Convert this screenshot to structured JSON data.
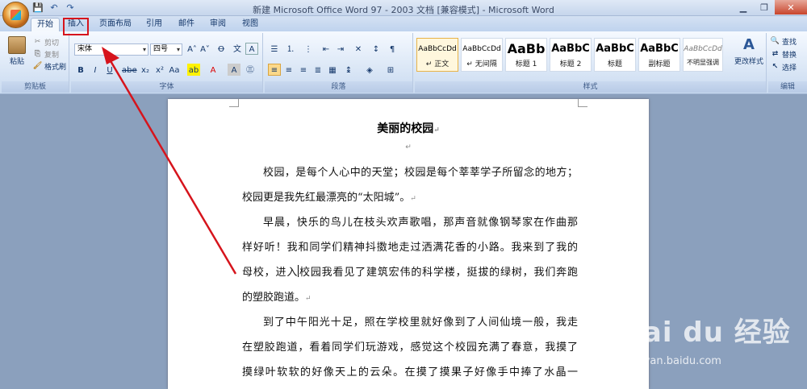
{
  "window": {
    "title": "新建 Microsoft Office Word 97 - 2003 文档 [兼容模式] - Microsoft Word",
    "controls": [
      "minimize",
      "restore",
      "close"
    ]
  },
  "qat_icons": [
    "save-icon",
    "undo-icon",
    "redo-icon"
  ],
  "tabs": [
    {
      "label": "开始",
      "active": true
    },
    {
      "label": "插入",
      "active": false,
      "highlighted": true
    },
    {
      "label": "页面布局",
      "active": false
    },
    {
      "label": "引用",
      "active": false
    },
    {
      "label": "邮件",
      "active": false
    },
    {
      "label": "审阅",
      "active": false
    },
    {
      "label": "视图",
      "active": false
    }
  ],
  "ribbon": {
    "clipboard": {
      "label": "剪贴板",
      "paste": "粘贴",
      "cut": "剪切",
      "copy": "复制",
      "format_painter": "格式刷"
    },
    "font": {
      "label": "字体",
      "font_name": "宋体",
      "font_size": "四号"
    },
    "paragraph": {
      "label": "段落"
    },
    "styles": {
      "label": "样式",
      "items": [
        {
          "preview": "AaBbCcDd",
          "name": "↵ 正文",
          "selected": true
        },
        {
          "preview": "AaBbCcDd",
          "name": "↵ 无间隔",
          "selected": false
        },
        {
          "preview": "AaBb",
          "name": "标题 1",
          "selected": false
        },
        {
          "preview": "AaBbC",
          "name": "标题 2",
          "selected": false
        },
        {
          "preview": "AaBbC",
          "name": "标题",
          "selected": false
        },
        {
          "preview": "AaBbC",
          "name": "副标题",
          "selected": false
        },
        {
          "preview": "AaBbCcDd",
          "name": "不明显强调",
          "selected": false
        }
      ],
      "change_styles": "更改样式"
    },
    "editing": {
      "label": "编辑",
      "find": "查找",
      "replace": "替换",
      "select": "选择"
    }
  },
  "document": {
    "title": "美丽的校园",
    "paragraphs": [
      {
        "lines": [
          "校园，是每个人心中的天堂；校园是每个莘莘学子所留念的地方；",
          "校园更是我先红最漂亮的“太阳城”。"
        ]
      },
      {
        "lines": [
          "早晨，快乐的鸟儿在枝头欢声歌唱，那声音就像钢琴家在作曲那",
          "样好听！我和同学们精神抖擞地走过洒满花香的小路。我来到了我的",
          "母校，进入",
          "校园我看见了建筑宏伟的科学楼，挺拔的绿树，我们奔跑",
          "的塑胶跑道。"
        ]
      },
      {
        "lines": [
          "到了中午阳光十足，照在学校里就好像到了人间仙境一般，我走",
          "在塑胶跑道，看着同学们玩游戏，感觉这个校园充满了春意，我摸了",
          "摸绿叶软软的好像天上的云朵。在摸了摸果子好像手中捧了水晶一"
        ]
      }
    ],
    "return_mark": "↵"
  },
  "watermark": {
    "brand": "Bai du 经验",
    "url": "jingyan.baidu.com"
  },
  "accent_colors": {
    "annotation_red": "#d6141c",
    "ribbon_blue": "#15386b"
  }
}
